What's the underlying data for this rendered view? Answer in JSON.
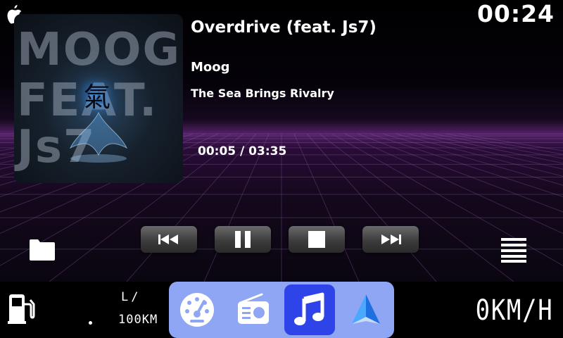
{
  "status": {
    "clock": "00:24"
  },
  "player": {
    "track_title": "Overdrive (feat. Js7)",
    "artist": "Moog",
    "album": "The Sea Brings Rivalry",
    "elapsed": "00:05",
    "duration": "03:35",
    "time_display": "00:05 / 03:35"
  },
  "album_art": {
    "text_lines": [
      "MOOG",
      "FEAT.",
      "Js7"
    ],
    "glyph": "氣"
  },
  "controls": [
    "previous",
    "pause",
    "stop",
    "next"
  ],
  "trip": {
    "consumption_unit_top": "L/",
    "consumption_unit_bottom": "100KM",
    "consumption_value": ".",
    "speed": "0KM/H"
  },
  "dock": {
    "items": [
      "dashboard",
      "radio",
      "music",
      "navigation"
    ],
    "active": "music"
  },
  "colors": {
    "dock_bg": "#8fa6f5",
    "dock_active": "#2f44e8",
    "nav_blue": "#2d8cff"
  }
}
